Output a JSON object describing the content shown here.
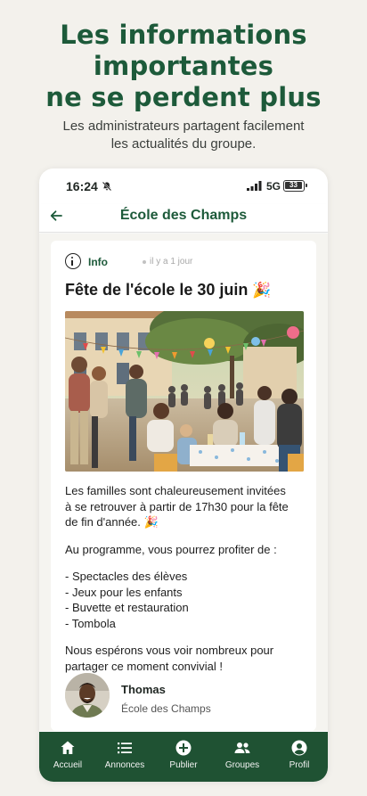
{
  "hero": {
    "title_line1": "Les informations",
    "title_line2": "importantes",
    "title_line3": "ne se perdent plus",
    "subtitle_line1": "Les administrateurs partagent facilement",
    "subtitle_line2": "les actualités du groupe."
  },
  "status_bar": {
    "time": "16:24",
    "network": "5G",
    "battery": "33"
  },
  "app_bar": {
    "title": "École des Champs"
  },
  "post": {
    "badge": "Info",
    "time_ago": "il y a 1 jour",
    "title": "Fête de l'école le 30 juin",
    "title_emoji": "🎉",
    "paragraph1_line1": "Les familles sont chaleureusement invitées",
    "paragraph1_line2": "à se retrouver à partir de 17h30 pour la fête",
    "paragraph1_line3": "de fin d'année.",
    "paragraph1_emoji": "🎉",
    "program_intro": "Au programme, vous pourrez profiter de :",
    "program_items": [
      "- Spectacles des élèves",
      "- Jeux pour les enfants",
      "- Buvette et restauration",
      "- Tombola"
    ],
    "closing_line1": "Nous espérons vous voir nombreux pour",
    "closing_line2": "partager ce moment convivial !",
    "author_name": "Thomas",
    "author_org": "École des Champs"
  },
  "tabs": [
    {
      "label": "Accueil",
      "icon": "home-icon"
    },
    {
      "label": "Annonces",
      "icon": "list-icon"
    },
    {
      "label": "Publier",
      "icon": "add-circle-icon"
    },
    {
      "label": "Groupes",
      "icon": "people-icon"
    },
    {
      "label": "Profil",
      "icon": "account-icon"
    }
  ],
  "colors": {
    "brand_green": "#1d5a3a",
    "tabbar_green": "#1f5233"
  }
}
